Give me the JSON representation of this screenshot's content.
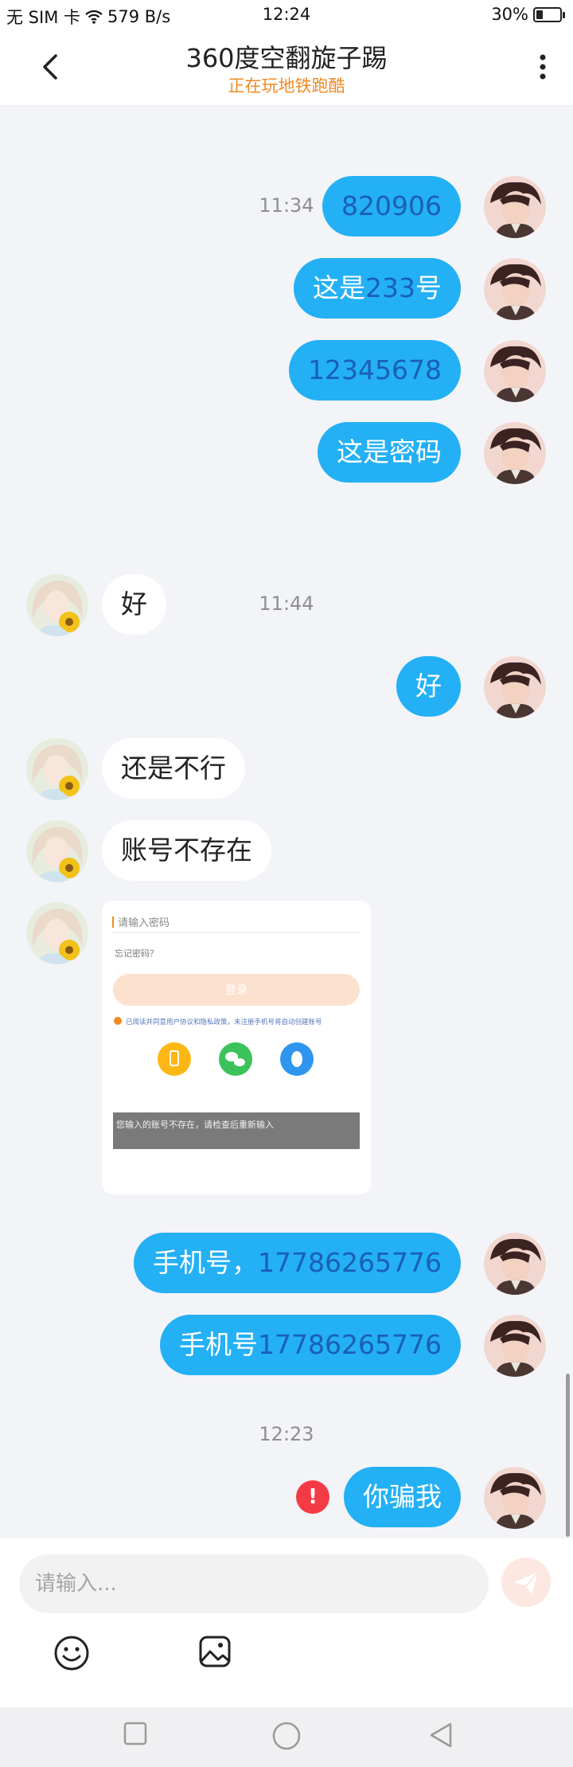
{
  "status_bar": {
    "carrier": "无 SIM 卡",
    "speed": "579 B/s",
    "time": "12:24",
    "battery": "30%",
    "battery_level": 0.3,
    "icons": [
      "wifi-icon",
      "battery-icon"
    ]
  },
  "header": {
    "title": "360度空翻旋子踢",
    "subtitle": "正在玩地铁跑酷",
    "back_icon": "chevron-left-icon",
    "more_icon": "more-vertical-icon"
  },
  "messages": {
    "time_1": "11:34",
    "m1": "820906",
    "m2_prefix": "这是",
    "m2_num": "233",
    "m2_suffix": "号",
    "m3": "12345678",
    "m4": "这是密码",
    "time_2": "11:44",
    "m5": "好",
    "m6": "好",
    "m7": "还是不行",
    "m8": "账号不存在",
    "m10_prefix": "手机号，",
    "m10_num": "17786265776",
    "m11_prefix": "手机号",
    "m11_num": "17786265776",
    "time_3": "12:23",
    "m12": "你骗我",
    "m12_error": "!"
  },
  "image_message": {
    "field1": "请输入密码",
    "field2": "忘记密码？",
    "login_button": "登录",
    "agreement": "已阅读并同意用户协议和隐私政策，未注册手机号将自动创建账号",
    "toast": "您输入的账号不存在，请检查后重新输入"
  },
  "input": {
    "placeholder": "请输入...",
    "icons": [
      "send-icon",
      "emoji-icon",
      "image-icon"
    ]
  },
  "nav_bar": {
    "icons": [
      "recent-apps-icon",
      "home-icon",
      "back-icon"
    ]
  },
  "colors": {
    "bubble_out": "#24b0f5",
    "bubble_in": "#ffffff",
    "number_text": "#1a5fb6",
    "subtitle": "#f08a24",
    "error": "#f43b45"
  }
}
